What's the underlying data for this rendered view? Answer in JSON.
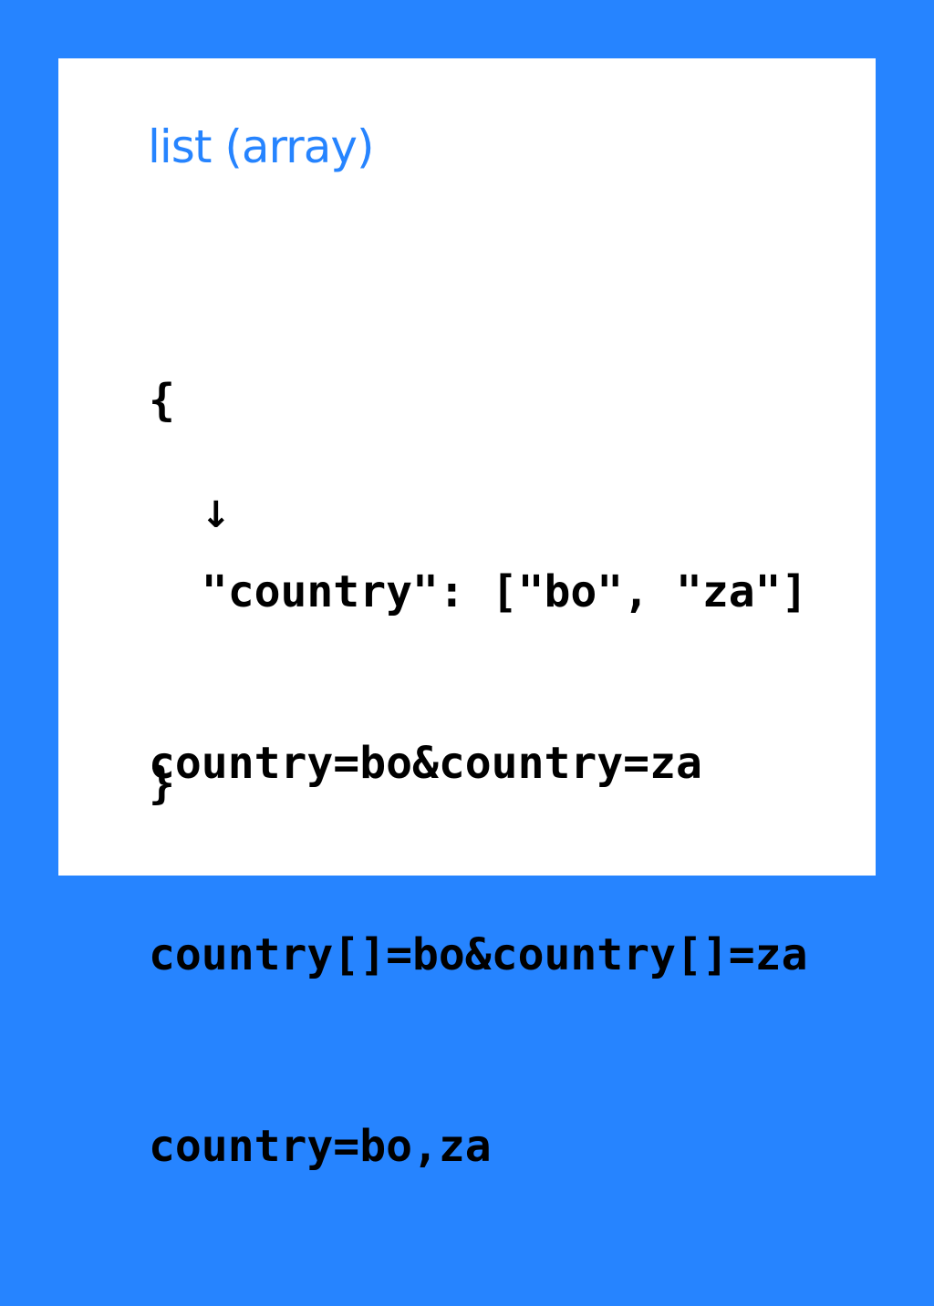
{
  "title": "list (array)",
  "json_example": {
    "open_brace": "{",
    "body_line": "  \"country\": [\"bo\", \"za\"]",
    "close_brace": "}"
  },
  "arrow": "↓",
  "serializations": [
    "country=bo&country=za",
    "country[]=bo&country[]=za",
    "country=bo,za"
  ],
  "colors": {
    "accent": "#2684ff",
    "background": "#ffffff"
  }
}
